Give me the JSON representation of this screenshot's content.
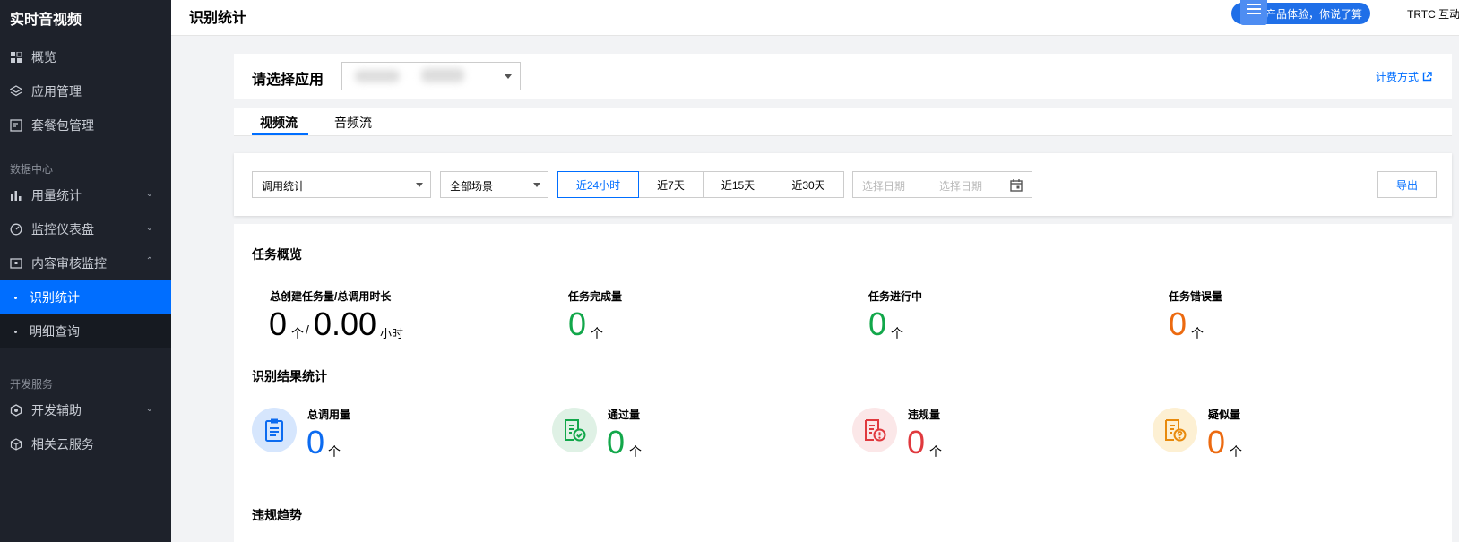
{
  "sidebar": {
    "title": "实时音视频",
    "items": [
      {
        "label": "概览"
      },
      {
        "label": "应用管理"
      },
      {
        "label": "套餐包管理"
      }
    ],
    "section_data": "数据中心",
    "data_items": [
      {
        "label": "用量统计"
      },
      {
        "label": "监控仪表盘"
      },
      {
        "label": "内容审核监控"
      }
    ],
    "sub_items": [
      {
        "label": "识别统计"
      },
      {
        "label": "明细查询"
      }
    ],
    "section_dev": "开发服务",
    "dev_items": [
      {
        "label": "开发辅助"
      },
      {
        "label": "相关云服务"
      }
    ]
  },
  "header": {
    "title": "识别统计",
    "promo": "产品体验，你说了算",
    "user": "TRTC 互动"
  },
  "app": {
    "label": "请选择应用",
    "billing": "计费方式"
  },
  "tabs": [
    {
      "label": "视频流"
    },
    {
      "label": "音频流"
    }
  ],
  "filter": {
    "type": "调用统计",
    "scene": "全部场景",
    "ranges": [
      "近24小时",
      "近7天",
      "近15天",
      "近30天"
    ],
    "date_start": "选择日期",
    "date_end": "选择日期",
    "export": "导出"
  },
  "overview": {
    "title": "任务概览",
    "total_label": "总创建任务量/总调用时长",
    "total_count": "0",
    "count_unit": "个",
    "sep": "/",
    "total_duration": "0.00",
    "duration_unit": "小时",
    "done_label": "任务完成量",
    "done_value": "0",
    "running_label": "任务进行中",
    "running_value": "0",
    "error_label": "任务错误量",
    "error_value": "0"
  },
  "results": {
    "title": "识别结果统计",
    "total_label": "总调用量",
    "total_value": "0",
    "pass_label": "通过量",
    "pass_value": "0",
    "violation_label": "违规量",
    "violation_value": "0",
    "suspect_label": "疑似量",
    "suspect_value": "0",
    "unit": "个"
  },
  "trend": {
    "title": "违规趋势"
  },
  "colors": {
    "accent": "#006eff",
    "green": "#12a74a",
    "orange": "#ec6a10",
    "red": "#e0393e",
    "sidebar_bg": "#1e222b"
  }
}
